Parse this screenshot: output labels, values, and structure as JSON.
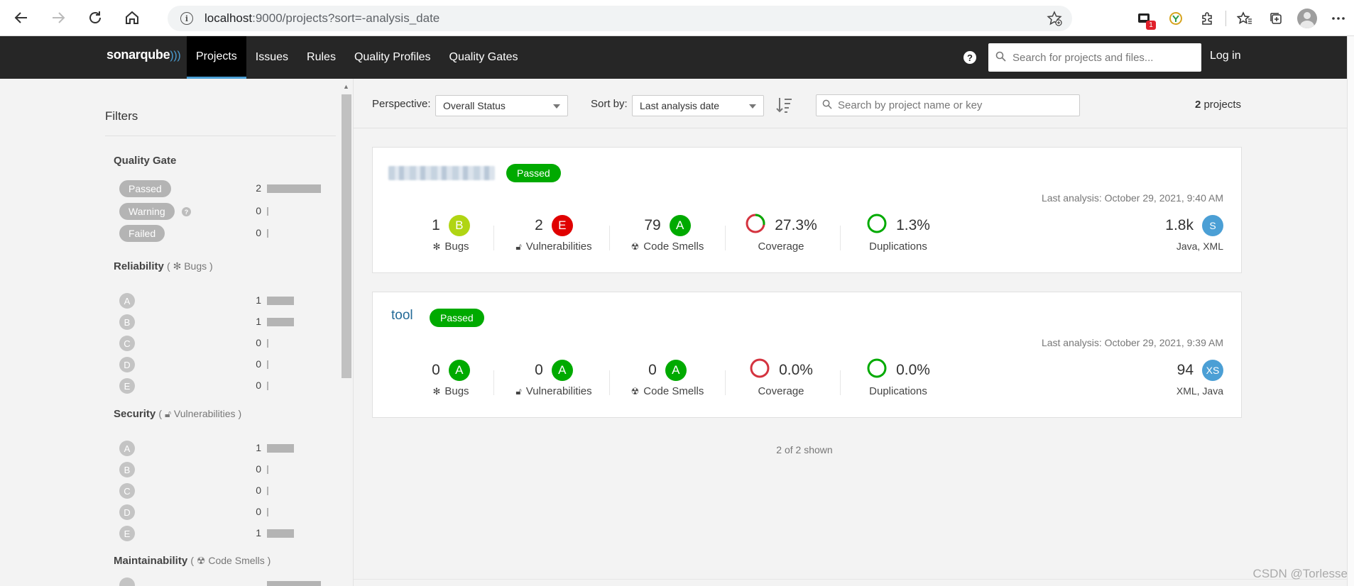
{
  "browser": {
    "url_host": "localhost",
    "url_path": ":9000/projects?sort=-analysis_date",
    "ext_badge": "1"
  },
  "header": {
    "logo": "sonarqube",
    "nav": [
      "Projects",
      "Issues",
      "Rules",
      "Quality Profiles",
      "Quality Gates"
    ],
    "active_nav": "Projects",
    "search_placeholder": "Search for projects and files...",
    "login": "Log in",
    "help_glyph": "?"
  },
  "filters": {
    "title": "Filters",
    "quality_gate": {
      "title": "Quality Gate",
      "items": [
        {
          "label": "Passed",
          "count": "2",
          "fraction": 1.0
        },
        {
          "label": "Warning",
          "count": "0",
          "fraction": 0
        },
        {
          "label": "Failed",
          "count": "0",
          "fraction": 0
        }
      ]
    },
    "reliability": {
      "title": "Reliability",
      "paren_open": "(",
      "sub": "Bugs",
      "paren_close": ")",
      "items": [
        {
          "label": "A",
          "count": "1",
          "fraction": 0.5
        },
        {
          "label": "B",
          "count": "1",
          "fraction": 0.5
        },
        {
          "label": "C",
          "count": "0",
          "fraction": 0
        },
        {
          "label": "D",
          "count": "0",
          "fraction": 0
        },
        {
          "label": "E",
          "count": "0",
          "fraction": 0
        }
      ]
    },
    "security": {
      "title": "Security",
      "paren_open": "(",
      "sub": "Vulnerabilities",
      "paren_close": ")",
      "items": [
        {
          "label": "A",
          "count": "1",
          "fraction": 0.5
        },
        {
          "label": "B",
          "count": "0",
          "fraction": 0
        },
        {
          "label": "C",
          "count": "0",
          "fraction": 0
        },
        {
          "label": "D",
          "count": "0",
          "fraction": 0
        },
        {
          "label": "E",
          "count": "1",
          "fraction": 0.5
        }
      ]
    },
    "maintainability": {
      "title": "Maintainability",
      "paren_open": "(",
      "sub": "Code Smells",
      "paren_close": ")"
    }
  },
  "toolbar": {
    "perspective_label": "Perspective:",
    "perspective_value": "Overall Status",
    "sort_label": "Sort by:",
    "sort_value": "Last analysis date",
    "search_placeholder": "Search by project name or key",
    "count_number": "2",
    "count_word": "projects"
  },
  "projects": [
    {
      "name": "",
      "status": "Passed",
      "last_analysis": "Last analysis: October 29, 2021, 9:40 AM",
      "bugs": "1",
      "bugs_rating": "B",
      "bugs_label": "Bugs",
      "vulns": "2",
      "vulns_rating": "E",
      "vulns_label": "Vulnerabilities",
      "smells": "79",
      "smells_rating": "A",
      "smells_label": "Code Smells",
      "coverage": "27.3%",
      "coverage_fraction": 0.273,
      "coverage_label": "Coverage",
      "duplications": "1.3%",
      "dup_fraction": 0.013,
      "dup_label": "Duplications",
      "size": "1.8k",
      "size_rating": "S",
      "languages": "Java, XML"
    },
    {
      "name": "tool",
      "status": "Passed",
      "last_analysis": "Last analysis: October 29, 2021, 9:39 AM",
      "bugs": "0",
      "bugs_rating": "A",
      "bugs_label": "Bugs",
      "vulns": "0",
      "vulns_rating": "A",
      "vulns_label": "Vulnerabilities",
      "smells": "0",
      "smells_rating": "A",
      "smells_label": "Code Smells",
      "coverage": "0.0%",
      "coverage_fraction": 0.0,
      "coverage_label": "Coverage",
      "duplications": "0.0%",
      "dup_fraction": 0.0,
      "dup_label": "Duplications",
      "size": "94",
      "size_rating": "XS",
      "languages": "XML, Java"
    }
  ],
  "shown": "2 of 2 shown",
  "watermark": "CSDN @Torlesse",
  "colors": {
    "rating_A": "#00aa00",
    "rating_B": "#b0d513",
    "rating_E": "#e00000",
    "passed": "#00aa00",
    "accent": "#4b9fd5",
    "coverage_bad": "#d4333f"
  }
}
